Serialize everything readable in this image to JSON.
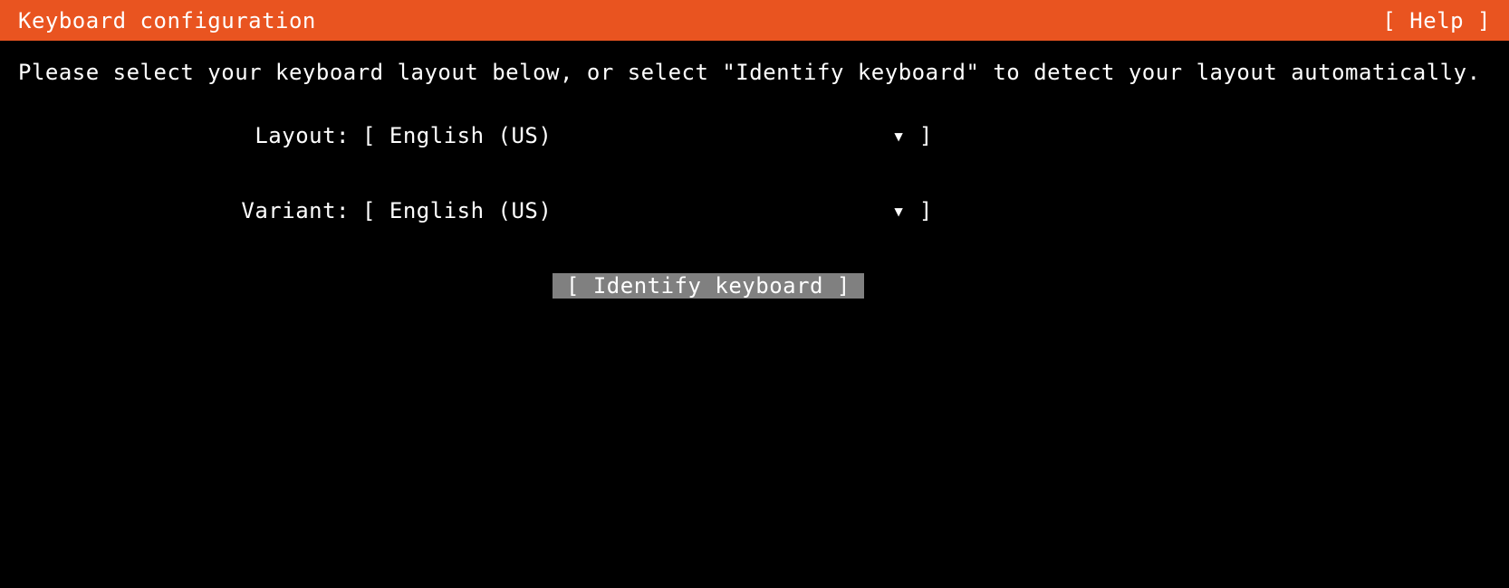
{
  "header": {
    "title": "Keyboard configuration",
    "help": "[ Help ]"
  },
  "instruction": "Please select your keyboard layout below, or select \"Identify keyboard\" to detect your layout automatically.",
  "fields": {
    "layout": {
      "label": "Layout:",
      "bracket_open": "[ ",
      "value": "English (US)",
      "arrow": "▾ ",
      "bracket_close": "]"
    },
    "variant": {
      "label": "Variant:",
      "bracket_open": "[ ",
      "value": "English (US)",
      "arrow": "▾ ",
      "bracket_close": "]"
    }
  },
  "buttons": {
    "identify": " [ Identify keyboard ] "
  },
  "colors": {
    "header_bg": "#E95420",
    "background": "#000000",
    "text": "#ffffff",
    "highlight_bg": "#808080"
  }
}
